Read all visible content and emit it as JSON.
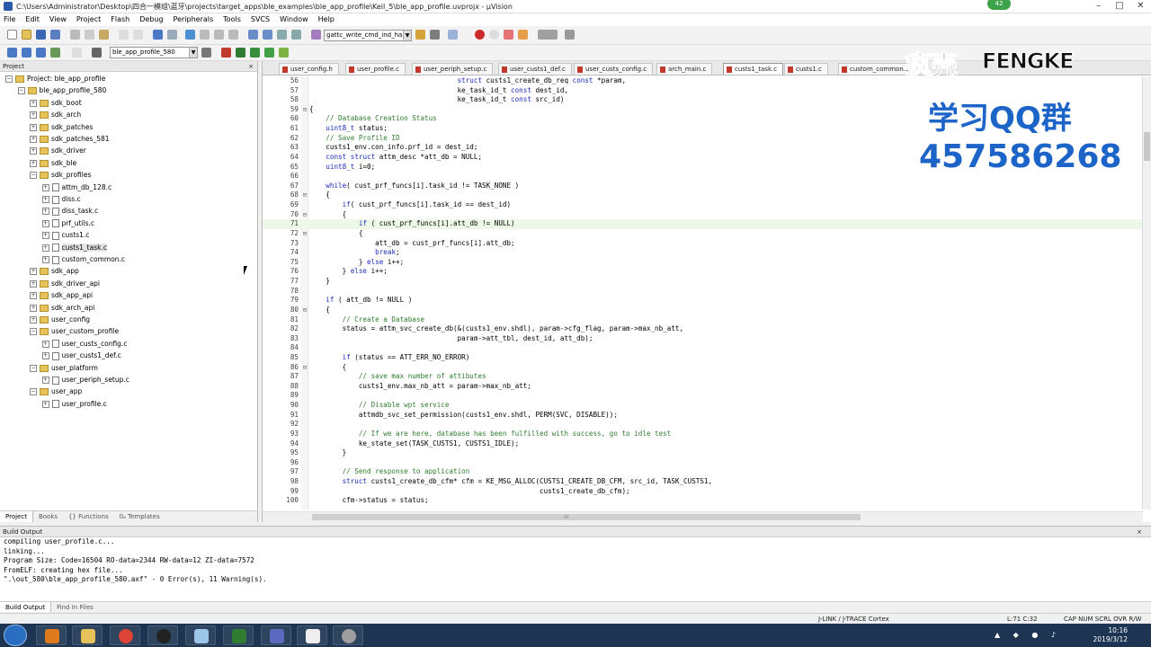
{
  "window": {
    "title": "C:\\Users\\Administrator\\Desktop\\四合一模组\\蓝牙\\projects\\target_apps\\ble_examples\\ble_app_profile\\Keil_5\\ble_app_profile.uvprojx - µVision",
    "minimize": "–",
    "maximize": "□",
    "close": "✕",
    "notification_count": "42"
  },
  "menu": [
    "File",
    "Edit",
    "View",
    "Project",
    "Flash",
    "Debug",
    "Peripherals",
    "Tools",
    "SVCS",
    "Window",
    "Help"
  ],
  "toolbar": {
    "find_combo": "gattc_write_cmd_ind_har",
    "target_combo": "ble_app_profile_580"
  },
  "project_panel": {
    "title": "Project",
    "close": "×",
    "tree": [
      {
        "label": "Project: ble_app_profile",
        "depth": 0,
        "kind": "root",
        "exp": "−"
      },
      {
        "label": "ble_app_profile_580",
        "depth": 1,
        "kind": "folder",
        "exp": "−"
      },
      {
        "label": "sdk_boot",
        "depth": 2,
        "kind": "folder",
        "exp": "+"
      },
      {
        "label": "sdk_arch",
        "depth": 2,
        "kind": "folder",
        "exp": "+"
      },
      {
        "label": "sdk_patches",
        "depth": 2,
        "kind": "folder",
        "exp": "+"
      },
      {
        "label": "sdk_patches_581",
        "depth": 2,
        "kind": "folder",
        "exp": "+"
      },
      {
        "label": "sdk_driver",
        "depth": 2,
        "kind": "folder",
        "exp": "+"
      },
      {
        "label": "sdk_ble",
        "depth": 2,
        "kind": "folder",
        "exp": "+"
      },
      {
        "label": "sdk_profiles",
        "depth": 2,
        "kind": "folder",
        "exp": "−"
      },
      {
        "label": "attm_db_128.c",
        "depth": 3,
        "kind": "file",
        "exp": "+"
      },
      {
        "label": "diss.c",
        "depth": 3,
        "kind": "file",
        "exp": "+"
      },
      {
        "label": "diss_task.c",
        "depth": 3,
        "kind": "file",
        "exp": "+"
      },
      {
        "label": "prf_utils.c",
        "depth": 3,
        "kind": "file",
        "exp": "+"
      },
      {
        "label": "custs1.c",
        "depth": 3,
        "kind": "file",
        "exp": "+"
      },
      {
        "label": "custs1_task.c",
        "depth": 3,
        "kind": "file",
        "exp": "+",
        "selected": true
      },
      {
        "label": "custom_common.c",
        "depth": 3,
        "kind": "file",
        "exp": "+"
      },
      {
        "label": "sdk_app",
        "depth": 2,
        "kind": "folder",
        "exp": "+"
      },
      {
        "label": "sdk_driver_api",
        "depth": 2,
        "kind": "folder",
        "exp": "+"
      },
      {
        "label": "sdk_app_api",
        "depth": 2,
        "kind": "folder",
        "exp": "+"
      },
      {
        "label": "sdk_arch_api",
        "depth": 2,
        "kind": "folder",
        "exp": "+"
      },
      {
        "label": "user_config",
        "depth": 2,
        "kind": "folder",
        "exp": "+"
      },
      {
        "label": "user_custom_profile",
        "depth": 2,
        "kind": "folder",
        "exp": "−"
      },
      {
        "label": "user_custs_config.c",
        "depth": 3,
        "kind": "file",
        "exp": "+"
      },
      {
        "label": "user_custs1_def.c",
        "depth": 3,
        "kind": "file",
        "exp": "+"
      },
      {
        "label": "user_platform",
        "depth": 2,
        "kind": "folder",
        "exp": "−"
      },
      {
        "label": "user_periph_setup.c",
        "depth": 3,
        "kind": "file",
        "exp": "+"
      },
      {
        "label": "user_app",
        "depth": 2,
        "kind": "folder",
        "exp": "−"
      },
      {
        "label": "user_profile.c",
        "depth": 3,
        "kind": "file",
        "exp": "+"
      }
    ],
    "tabs": [
      "Project",
      "Books",
      "{} Functions",
      "0ₐ Templates"
    ]
  },
  "editor": {
    "tabs": [
      {
        "label": "user_config.h",
        "active": false
      },
      {
        "label": "user_profile.c",
        "active": false
      },
      {
        "label": "user_periph_setup.c",
        "active": false
      },
      {
        "label": "user_custs1_def.c",
        "active": false
      },
      {
        "label": "user_custs_config.c",
        "active": false
      },
      {
        "label": "arch_main.c",
        "active": false
      },
      {
        "label": "custs1_task.c",
        "active": true
      },
      {
        "label": "custs1.c",
        "active": false
      },
      {
        "label": "custom_common.c",
        "active": false
      }
    ],
    "lines": [
      {
        "n": "56",
        "t": "                                    struct custs1_create_db_req const *param,"
      },
      {
        "n": "57",
        "t": "                                    ke_task_id_t const dest_id,"
      },
      {
        "n": "58",
        "t": "                                    ke_task_id_t const src_id)"
      },
      {
        "n": "59",
        "t": "{",
        "fold": "⊟"
      },
      {
        "n": "60",
        "t": "    // Database Creation Status",
        "c": 1
      },
      {
        "n": "61",
        "t": "    uint8_t status;"
      },
      {
        "n": "62",
        "t": "    // Save Profile ID",
        "c": 1
      },
      {
        "n": "63",
        "t": "    custs1_env.con_info.prf_id = dest_id;"
      },
      {
        "n": "64",
        "t": "    const struct attm_desc *att_db = NULL;"
      },
      {
        "n": "65",
        "t": "    uint8_t i=0;"
      },
      {
        "n": "66",
        "t": ""
      },
      {
        "n": "67",
        "t": "    while( cust_prf_funcs[i].task_id != TASK_NONE )"
      },
      {
        "n": "68",
        "t": "    {",
        "fold": "⊟"
      },
      {
        "n": "69",
        "t": "        if( cust_prf_funcs[i].task_id == dest_id)"
      },
      {
        "n": "70",
        "t": "        {",
        "fold": "⊟"
      },
      {
        "n": "71",
        "t": "            if ( cust_prf_funcs[i].att_db != NULL)",
        "hl": true
      },
      {
        "n": "72",
        "t": "            {",
        "fold": "⊟"
      },
      {
        "n": "73",
        "t": "                att_db = cust_prf_funcs[i].att_db;"
      },
      {
        "n": "74",
        "t": "                break;"
      },
      {
        "n": "75",
        "t": "            } else i++;"
      },
      {
        "n": "76",
        "t": "        } else i++;"
      },
      {
        "n": "77",
        "t": "    }"
      },
      {
        "n": "78",
        "t": ""
      },
      {
        "n": "79",
        "t": "    if ( att_db != NULL )"
      },
      {
        "n": "80",
        "t": "    {",
        "fold": "⊟"
      },
      {
        "n": "81",
        "t": "        // Create a Database",
        "c": 1
      },
      {
        "n": "82",
        "t": "        status = attm_svc_create_db(&(custs1_env.shdl), param->cfg_flag, param->max_nb_att,"
      },
      {
        "n": "83",
        "t": "                                    param->att_tbl, dest_id, att_db);"
      },
      {
        "n": "84",
        "t": ""
      },
      {
        "n": "85",
        "t": "        if (status == ATT_ERR_NO_ERROR)"
      },
      {
        "n": "86",
        "t": "        {",
        "fold": "⊟"
      },
      {
        "n": "87",
        "t": "            // save max number of attibutes",
        "c": 1
      },
      {
        "n": "88",
        "t": "            custs1_env.max_nb_att = param->max_nb_att;"
      },
      {
        "n": "89",
        "t": ""
      },
      {
        "n": "90",
        "t": "            // Disable wpt service",
        "c": 1
      },
      {
        "n": "91",
        "t": "            attmdb_svc_set_permission(custs1_env.shdl, PERM(SVC, DISABLE));"
      },
      {
        "n": "92",
        "t": ""
      },
      {
        "n": "93",
        "t": "            // If we are here, database has been fulfilled with success, go to idle test",
        "c": 1
      },
      {
        "n": "94",
        "t": "            ke_state_set(TASK_CUSTS1, CUSTS1_IDLE);"
      },
      {
        "n": "95",
        "t": "        }"
      },
      {
        "n": "96",
        "t": ""
      },
      {
        "n": "97",
        "t": "        // Send response to application",
        "c": 1
      },
      {
        "n": "98",
        "t": "        struct custs1_create_db_cfm* cfm = KE_MSG_ALLOC(CUSTS1_CREATE_DB_CFM, src_id, TASK_CUSTS1,"
      },
      {
        "n": "99",
        "t": "                                                        custs1_create_db_cfm);"
      },
      {
        "n": "100",
        "t": "        cfm->status = status;"
      }
    ]
  },
  "build_output": {
    "title": "Build Output",
    "close": "×",
    "lines": [
      "compiling user_profile.c...",
      "linking...",
      "Program Size: Code=16504 RO-data=2344 RW-data=12 ZI-data=7572",
      "FromELF: creating hex file...",
      "\".\\out_580\\ble_app_profile_580.axf\" - 0 Error(s), 11 Warning(s)."
    ],
    "tabs": [
      "Build Output",
      "Find In Files"
    ]
  },
  "status": {
    "debugger": "J-LINK / J-TRACE Cortex",
    "position": "L:71 C:32",
    "indicators": "CAP  NUM  SCRL  OVR  R/W"
  },
  "taskbar": {
    "time": "10:16",
    "date": "2019/3/12"
  },
  "watermark": {
    "logo_cn": "疯壳",
    "logo_en": "FENGKE",
    "line1": "学习QQ群",
    "line2": "457586268"
  },
  "colors": {
    "keyword": "#1a2dbd",
    "comment": "#2f7d2f",
    "watermark": "#1c64c8",
    "taskbar": "#1d3552",
    "active_line": "#eef8e8"
  }
}
